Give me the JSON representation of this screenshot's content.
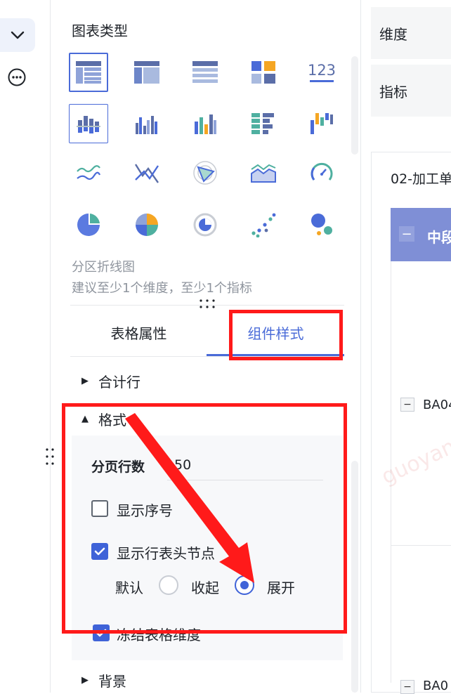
{
  "rail": {
    "collapse_icon": "chevron-down-icon",
    "more_icon": "more-circle-icon"
  },
  "panel": {
    "title": "图表类型",
    "chart_types_row1": [
      "cross-table",
      "grouped-table",
      "detail-table",
      "kpi-blocks",
      "number-card"
    ],
    "chart_types_row2": [
      "partition-bar",
      "grouped-bar",
      "stacked-bar",
      "horizontal-bar",
      "waterfall"
    ],
    "chart_types_row3": [
      "partition-line",
      "multi-line",
      "radar",
      "area",
      "gauge"
    ],
    "chart_types_row4": [
      "pie",
      "rose-pie",
      "ring",
      "scatter",
      "bubble"
    ],
    "number_card_label": "123",
    "selected_chart_name": "分区折线图",
    "selected_chart_hint": "建议至少1个维度，至少1个指标"
  },
  "tabs": {
    "table_props": "表格属性",
    "component_style": "组件样式"
  },
  "sections": {
    "total_row": "合计行",
    "format": "格式",
    "background": "背景"
  },
  "format": {
    "page_rows_label": "分页行数",
    "page_rows_value": "50",
    "show_index": "显示序号",
    "show_header_nodes": "显示行表头节点",
    "default_label": "默认",
    "collapse_label": "收起",
    "expand_label": "展开",
    "freeze_dims": "冻结表格维度"
  },
  "right": {
    "dimension": "维度",
    "metric": "指标",
    "preview_title": "02-加工单",
    "header_text": "中段",
    "row1": "BA04",
    "row2": "BA0"
  },
  "watermark": "guoyan",
  "colors": {
    "accent": "#4a6bd8",
    "annotation": "#ff1a1a",
    "header": "#7f8fd6"
  }
}
